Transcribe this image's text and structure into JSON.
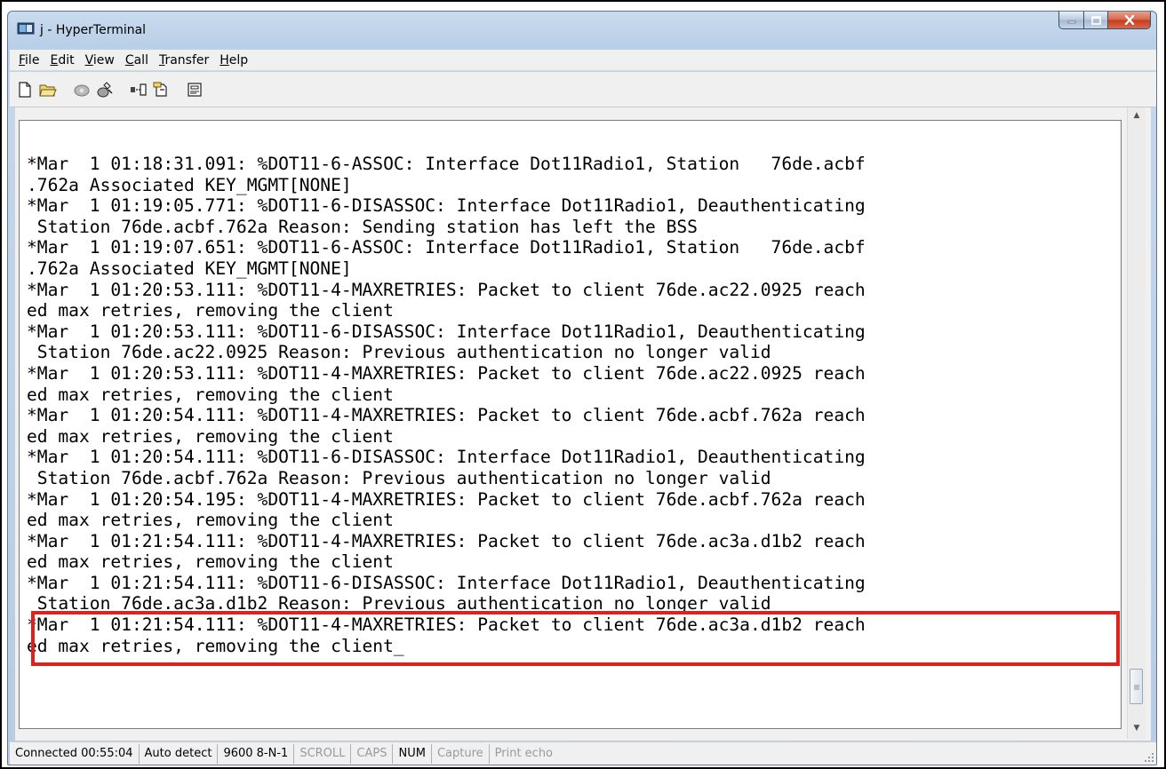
{
  "window": {
    "title": "j - HyperTerminal",
    "accent_color": "#c4391c"
  },
  "menu": [
    {
      "label": "File",
      "mnemonic": "F",
      "rest": "ile"
    },
    {
      "label": "Edit",
      "mnemonic": "E",
      "rest": "dit"
    },
    {
      "label": "View",
      "mnemonic": "V",
      "rest": "iew"
    },
    {
      "label": "Call",
      "mnemonic": "C",
      "rest": "all"
    },
    {
      "label": "Transfer",
      "mnemonic": "T",
      "rest": "ransfer"
    },
    {
      "label": "Help",
      "mnemonic": "H",
      "rest": "elp"
    }
  ],
  "toolbar": {
    "icons": [
      "new-file-icon",
      "open-folder-icon",
      "call-icon",
      "disconnect-icon",
      "send-icon",
      "receive-icon",
      "properties-icon"
    ]
  },
  "terminal": {
    "lines": [
      "*Mar  1 01:18:31.091: %DOT11-6-ASSOC: Interface Dot11Radio1, Station   76de.acbf",
      ".762a Associated KEY_MGMT[NONE]",
      "*Mar  1 01:19:05.771: %DOT11-6-DISASSOC: Interface Dot11Radio1, Deauthenticating",
      " Station 76de.acbf.762a Reason: Sending station has left the BSS",
      "*Mar  1 01:19:07.651: %DOT11-6-ASSOC: Interface Dot11Radio1, Station   76de.acbf",
      ".762a Associated KEY_MGMT[NONE]",
      "*Mar  1 01:20:53.111: %DOT11-4-MAXRETRIES: Packet to client 76de.ac22.0925 reach",
      "ed max retries, removing the client",
      "*Mar  1 01:20:53.111: %DOT11-6-DISASSOC: Interface Dot11Radio1, Deauthenticating",
      " Station 76de.ac22.0925 Reason: Previous authentication no longer valid",
      "*Mar  1 01:20:53.111: %DOT11-4-MAXRETRIES: Packet to client 76de.ac22.0925 reach",
      "ed max retries, removing the client",
      "*Mar  1 01:20:54.111: %DOT11-4-MAXRETRIES: Packet to client 76de.acbf.762a reach",
      "ed max retries, removing the client",
      "*Mar  1 01:20:54.111: %DOT11-6-DISASSOC: Interface Dot11Radio1, Deauthenticating",
      " Station 76de.acbf.762a Reason: Previous authentication no longer valid",
      "*Mar  1 01:20:54.195: %DOT11-4-MAXRETRIES: Packet to client 76de.acbf.762a reach",
      "ed max retries, removing the client",
      "*Mar  1 01:21:54.111: %DOT11-4-MAXRETRIES: Packet to client 76de.ac3a.d1b2 reach",
      "ed max retries, removing the client",
      "*Mar  1 01:21:54.111: %DOT11-6-DISASSOC: Interface Dot11Radio1, Deauthenticating",
      " Station 76de.ac3a.d1b2 Reason: Previous authentication no longer valid",
      "*Mar  1 01:21:54.111: %DOT11-4-MAXRETRIES: Packet to client 76de.ac3a.d1b2 reach",
      "ed max retries, removing the client_"
    ],
    "highlight_color": "#e0201c"
  },
  "statusbar": {
    "connected": "Connected 00:55:04",
    "detect": "Auto detect",
    "settings": "9600 8-N-1",
    "scroll": "SCROLL",
    "caps": "CAPS",
    "num": "NUM",
    "capture": "Capture",
    "print_echo": "Print echo"
  }
}
